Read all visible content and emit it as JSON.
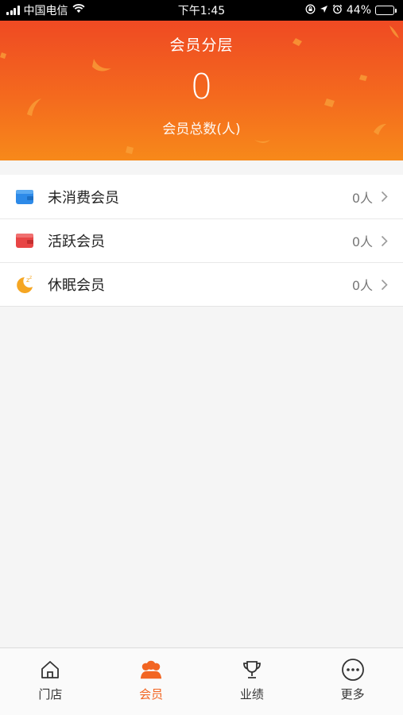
{
  "status_bar": {
    "carrier": "中国电信",
    "time": "下午1:45",
    "battery": "44%",
    "battery_level": 0.44,
    "icons": [
      "signal-icon",
      "wifi-icon",
      "screen-lock-icon",
      "location-icon",
      "alarm-icon",
      "battery-icon"
    ]
  },
  "header": {
    "title": "会员分层",
    "count": "0",
    "subtitle": "会员总数(人)"
  },
  "list": [
    {
      "icon": "wallet-blue-icon",
      "label": "未消费会员",
      "count": "0人"
    },
    {
      "icon": "wallet-red-icon",
      "label": "活跃会员",
      "count": "0人"
    },
    {
      "icon": "moon-sleep-icon",
      "label": "休眠会员",
      "count": "0人"
    }
  ],
  "tabbar": {
    "tabs": [
      {
        "icon": "home-icon",
        "label": "门店"
      },
      {
        "icon": "members-icon",
        "label": "会员"
      },
      {
        "icon": "trophy-icon",
        "label": "业绩"
      },
      {
        "icon": "more-icon",
        "label": "更多"
      }
    ],
    "active_index": 1
  },
  "colors": {
    "accent": "#f26522",
    "header_top": "#ef4a23",
    "header_bottom": "#f7891a",
    "blue_icon": "#2d8ae8",
    "red_icon": "#e84545",
    "moon_icon": "#f5a623"
  }
}
